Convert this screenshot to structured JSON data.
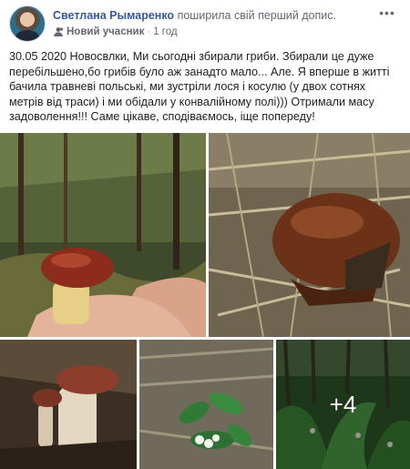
{
  "post": {
    "author": {
      "name": "Светлана Рымаренко",
      "action": "поширила свій перший допис."
    },
    "meta": {
      "badge": "Новий учасник",
      "separator": "·",
      "time": "1 год"
    },
    "more_icon": "ellipsis-icon",
    "text": "30.05 2020 Новосвлки, Ми сьогодні збирали гриби. Збирали це дуже перебільшено,бо грибів було аж занадто мало... Але. Я вперше в житті бачила травневі польські, ми зустріли лося і косулю (у двох сотнях метрів від траси) і ми обідали у конвалійному полі))) Отримали масу задоволення!!! Саме цікаве, сподіваємось, іще попереду!",
    "photos": {
      "more_count": "+4"
    }
  },
  "colors": {
    "link": "#385898",
    "secondary_text": "#606770",
    "primary_text": "#1c1e21"
  }
}
